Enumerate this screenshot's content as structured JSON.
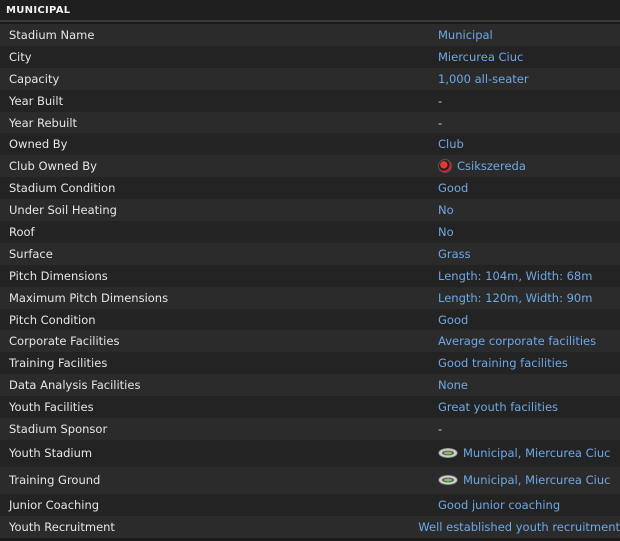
{
  "header": {
    "title": "MUNICIPAL"
  },
  "rows": [
    {
      "label": "Stadium Name",
      "value": "Municipal"
    },
    {
      "label": "City",
      "value": "Miercurea Ciuc"
    },
    {
      "label": "Capacity",
      "value": "1,000 all-seater"
    },
    {
      "label": "Year Built",
      "value": "-"
    },
    {
      "label": "Year Rebuilt",
      "value": "-"
    },
    {
      "label": "Owned By",
      "value": "Club"
    },
    {
      "label": "Club Owned By",
      "value": "Csikszereda",
      "icon": "club-badge-icon"
    },
    {
      "label": "Stadium Condition",
      "value": "Good"
    },
    {
      "label": "Under Soil Heating",
      "value": "No"
    },
    {
      "label": "Roof",
      "value": "No"
    },
    {
      "label": "Surface",
      "value": "Grass"
    },
    {
      "label": "Pitch Dimensions",
      "value": "Length: 104m, Width: 68m"
    },
    {
      "label": "Maximum Pitch Dimensions",
      "value": "Length: 120m, Width: 90m"
    },
    {
      "label": "Pitch Condition",
      "value": "Good"
    },
    {
      "label": "Corporate Facilities",
      "value": "Average corporate facilities"
    },
    {
      "label": "Training Facilities",
      "value": "Good training facilities"
    },
    {
      "label": "Data Analysis Facilities",
      "value": "None"
    },
    {
      "label": "Youth Facilities",
      "value": "Great youth facilities"
    },
    {
      "label": "Stadium Sponsor",
      "value": "-"
    },
    {
      "label": "Youth Stadium",
      "value": "Municipal, Miercurea Ciuc",
      "icon": "stadium-icon"
    },
    {
      "label": "Training Ground",
      "value": "Municipal, Miercurea Ciuc",
      "icon": "stadium-icon"
    },
    {
      "label": "Junior Coaching",
      "value": "Good junior coaching"
    },
    {
      "label": "Youth Recruitment",
      "value": "Well established youth recruitment"
    }
  ],
  "colors": {
    "background": "#1b1b1b",
    "row_odd": "#2b2b2b",
    "row_even": "#232323",
    "link": "#6ea8e6",
    "text": "#e6e6e6"
  }
}
